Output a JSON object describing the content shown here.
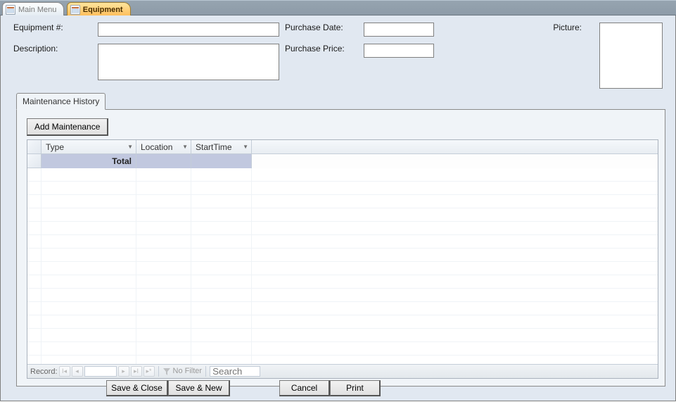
{
  "tabs": {
    "main_menu": "Main Menu",
    "equipment": "Equipment"
  },
  "fields": {
    "equipment_no_label": "Equipment #:",
    "equipment_no_value": "",
    "description_label": "Description:",
    "description_value": "",
    "purchase_date_label": "Purchase Date:",
    "purchase_date_value": "",
    "purchase_price_label": "Purchase Price:",
    "purchase_price_value": "",
    "picture_label": "Picture:"
  },
  "subform": {
    "tab_label": "Maintenance History",
    "add_button": "Add Maintenance",
    "columns": {
      "type": "Type",
      "location": "Location",
      "start_time": "StartTime"
    },
    "total_label": "Total",
    "nav": {
      "record_label": "Record:",
      "current": "",
      "filter_label": "No Filter",
      "search_placeholder": "Search"
    }
  },
  "footer": {
    "save_close": "Save & Close",
    "save_new": "Save & New",
    "cancel": "Cancel",
    "print": "Print"
  }
}
